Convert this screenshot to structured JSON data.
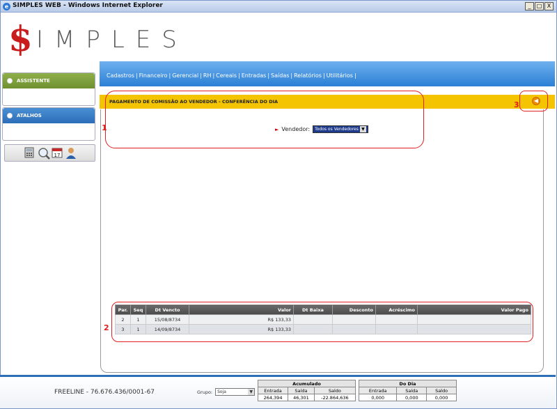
{
  "window": {
    "title": "SIMPLES WEB - Windows Internet Explorer",
    "buttons": [
      "_",
      "□",
      "X"
    ]
  },
  "logo": {
    "symbol": "$",
    "word": "IMPLES",
    "symbol_color": "#c91c1c"
  },
  "menu": {
    "items": [
      "Cadastros",
      "Financeiro",
      "Gerencial",
      "RH",
      "Cereais",
      "Entradas",
      "Saídas",
      "Relatórios",
      "Utilitários"
    ]
  },
  "sidebar": {
    "assistente": "ASSISTENTE",
    "atalhos": "ATALHOS",
    "tools": [
      "calculator-icon",
      "search-icon",
      "calendar-icon",
      "user-icon"
    ],
    "calendar_day": "17"
  },
  "page": {
    "title": "PAGAMENTO DE COMISSÃO AO VENDEDOR - CONFERÊNCIA DO DIA",
    "vendedor_label": "Vendedor:",
    "vendedor_value": "Todos os Vendedores"
  },
  "annotations": {
    "n1": "1",
    "n2": "2",
    "n3": "3"
  },
  "table": {
    "columns": [
      "Par.",
      "Seq",
      "Dt Vencto",
      "Valor",
      "Dt Baixa",
      "Desconto",
      "Acréscimo",
      "Valor Pago"
    ],
    "rows": [
      {
        "par": "2",
        "seq": "1",
        "dt_vencto": "15/08/8734",
        "valor": "R$ 133,33",
        "dt_baixa": "",
        "desconto": "",
        "acrescimo": "",
        "valor_pago": ""
      },
      {
        "par": "3",
        "seq": "1",
        "dt_vencto": "14/09/8734",
        "valor": "R$ 133,33",
        "dt_baixa": "",
        "desconto": "",
        "acrescimo": "",
        "valor_pago": ""
      }
    ]
  },
  "footer": {
    "freeline": "FREELINE - 76.676.436/0001-67",
    "grupo_label": "Grupo:",
    "grupo_value": "Soja",
    "acumulado": {
      "title": "Acumulado",
      "headers": [
        "Entrada",
        "Saída",
        "Saldo"
      ],
      "values": [
        "264,394",
        "46,301",
        "-22.864,636"
      ]
    },
    "dodia": {
      "title": "Do Dia",
      "headers": [
        "Entrada",
        "Saída",
        "Saldo"
      ],
      "values": [
        "0,000",
        "0,000",
        "0,000"
      ]
    }
  }
}
